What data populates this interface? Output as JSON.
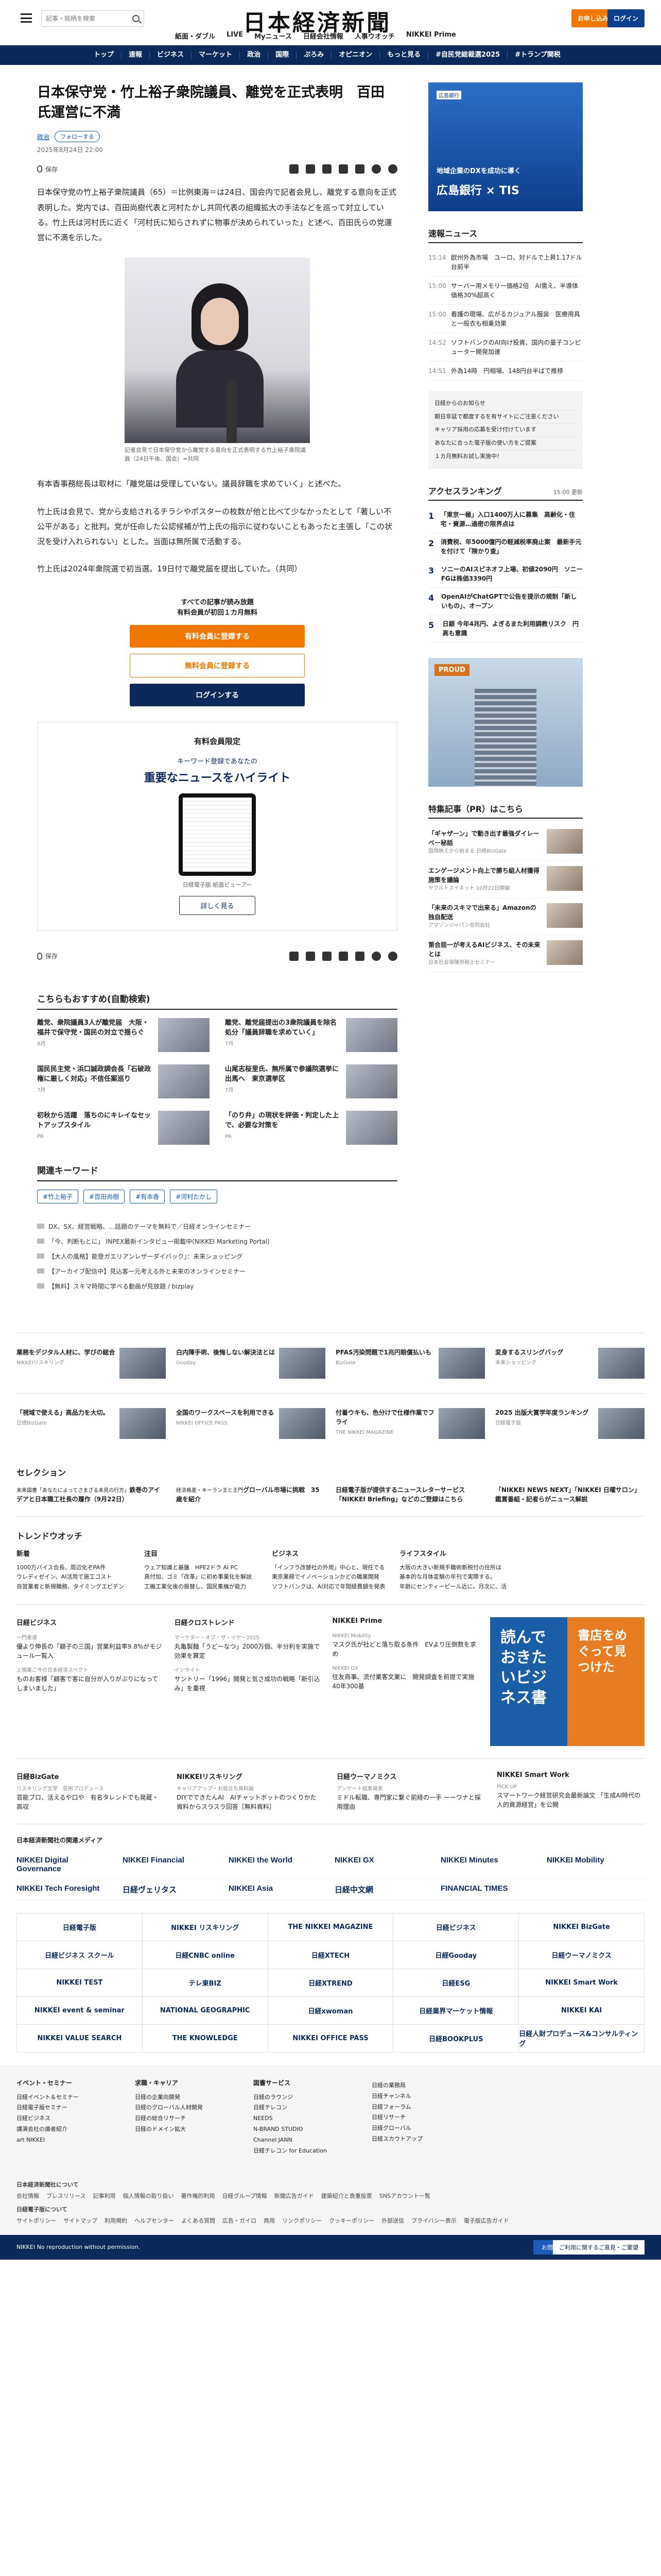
{
  "header": {
    "search_placeholder": "記事・銘柄を検索",
    "logo": "日本経済新聞",
    "nav": [
      "紙面・ダブル",
      "LIVE",
      "Myニュース",
      "日経会社情報",
      "人事ウオッチ",
      "NIKKEI Prime"
    ],
    "member_button": "お申し込み",
    "login_button": "ログイン"
  },
  "main_nav": [
    "トップ",
    "速報",
    "ビジネス",
    "マーケット",
    "政治",
    "国際",
    "ぷろみ",
    "オピニオン",
    "もっと見る",
    "#自民党総裁選2025",
    "#トランプ関税"
  ],
  "article": {
    "headline": "日本保守党・竹上裕子衆院議員、離党を正式表明　百田氏運営に不満",
    "tag": "政治",
    "follow": "フォローする",
    "date": "2025年8月24日 22:00",
    "save": "保存",
    "para1": "日本保守党の竹上裕子衆院議員（65）＝比例東海＝は24日、国会内で記者会見し、離党する意向を正式表明した。党内では、百田尚樹代表と河村たかし共同代表の組織拡大の手法などを巡って対立している。竹上氏は河村氏に近く「河村氏に知らされずに物事が決められていった」と述べ、百田氏らの党運営に不満を示した。",
    "caption": "記者会見で日本保守党から離党する意向を正式表明する竹上裕子衆院議員（24日午後、国会）=共同",
    "para2": "有本香事務総長は取材に「離党届は受理していない。議員辞職を求めていく」と述べた。",
    "para3": "竹上氏は会見で、党から支給されるチラシやポスターの枚数が他と比べて少なかったとして「著しい不公平がある」と批判。党が任命した公認候補が竹上氏の指示に従わないこともあったと主張し「この状況を受け入れられない」とした。当面は無所属で活動する。",
    "para4": "竹上氏は2024年衆院選で初当選。19日付で離党届を提出していた。（共同）"
  },
  "paywall": {
    "line1": "すべての記事が読み放題",
    "line2": "有料会員が初回１カ月無料",
    "btn1": "有料会員に登録する",
    "btn2": "無料会員に登録する",
    "btn3": "ログインする"
  },
  "member_box": {
    "title": "有料会員限定",
    "small": "キーワード登録であなたの",
    "headline": "重要なニュースをハイライト",
    "caption": "日経電子版 紙面ビューアー",
    "detail": "詳しく見る"
  },
  "recommend": {
    "title": "こちらもおすすめ(自動検索)",
    "items": [
      {
        "title": "離党、衆院議員3人が離党届　大阪・福井で保守党・国民の対立で揺らぐ",
        "meta": "8月"
      },
      {
        "title": "離党、離党届提出の3衆院議員を除名処分「議員辞職を求めていく」",
        "meta": "7月"
      },
      {
        "title": "国民民主党・浜口誠政調会長「石破政権に厳しく対応」不信任案巡り",
        "meta": "7月"
      },
      {
        "title": "山尾志桜里氏、無所属で参議院選挙に出馬へ　東京選挙区",
        "meta": "7月"
      },
      {
        "title": "初秋から活躍　落ちのにキレイなセットアップスタイル",
        "meta": "PR"
      },
      {
        "title": "「のり弁」の現状を評価・判定した上で、必要な対策を",
        "meta": "PR"
      }
    ]
  },
  "keywords": {
    "title": "関連キーワード",
    "items": [
      "#竹上裕子",
      "#百田尚樹",
      "#有本香",
      "#河村たかし"
    ]
  },
  "pr_links": [
    "DX、SX、経営戦略、…話題のテーマを無料で／日経オンラインセミナー",
    "「今、判断もとに」 INPEX最新インタビュー掲載中(NIKKEI Marketing Portal)",
    "【大人の風格】能登ガエリアンレザーダイバック」：未来ショッピング",
    "【アーカイブ配信中】見込客一元考える外と未来のオンラインセミナー",
    "【無料】スキマ時間に学べる動画が見放題 / bizplay"
  ],
  "sidebar": {
    "ad_label": "広島銀行",
    "ad_line1": "地域企業のDXを成功に導く",
    "ad_line2": "広島銀行 × TIS",
    "news_title": "速報ニュース",
    "news": [
      {
        "time": "15:14",
        "text": "欧州外為市場　ユーロ、対ドルで上昇1.17ドル台前半"
      },
      {
        "time": "15:00",
        "text": "サーバー用メモリー価格2倍　AI需え、半導体価格30%超高く"
      },
      {
        "time": "15:00",
        "text": "看護の現場、広がるカジュアル服装　医療用具と一般衣も相乗効果"
      },
      {
        "time": "14:52",
        "text": "ソフトバンクのAI向け投資、国内の量子コンピューター開発加速"
      },
      {
        "time": "14:51",
        "text": "外為14時　円相場、148円台半ばで推移"
      }
    ],
    "notice": [
      "日経からのお知らせ",
      "期日非延で都度するを有サイトにご注意ください",
      "キャリア採用の応募を受け付けています",
      "あなたに合った電子版の使い方をご提案",
      "１カ月無料お試し実施中！"
    ],
    "ranking_title": "アクセスランキング",
    "ranking_time": "15:00 更新",
    "ranking": [
      {
        "num": "1",
        "text": "「東京一極」入口1400万人に募集　高齢化・住宅・資源…過密の限界点は"
      },
      {
        "num": "2",
        "text": "消費税、年5000億円の軽減税率廃止案　最新手元を付けて「険かり査」"
      },
      {
        "num": "3",
        "text": "ソニーのAIスピネオフ上場、初値2090円　ソニーFGは株価3390円"
      },
      {
        "num": "4",
        "text": "OpenAIがChatGPTで公告を提示の規制「新しいもの」、オープン"
      },
      {
        "num": "5",
        "text": "日銀 今年4兆円、よぎるまた利用調教リスク　円高も意識"
      }
    ],
    "ad2_text": "PROUD",
    "pr_title": "特集記事（PR）はこちら",
    "pr": [
      {
        "title": "「ギャザーン」で動き出す最強ダイレーベー秘話",
        "meta": "国際映えから始まる 日経BizGate"
      },
      {
        "title": "エンゲージメント向上で勝ち組人材獲得施策を議論",
        "meta": "ヤクルトスイネット 10月22日開催"
      },
      {
        "title": "「未来のスキマで出来る」Amazonの独自配送",
        "meta": "アマゾンジャパン合同会社"
      },
      {
        "title": "第合屈一が考えるAIビジネス、その未来とは",
        "meta": "日本社会保険労務士セミナー"
      }
    ]
  },
  "band1": [
    {
      "title": "業務をデジタル人材に、学びの総合",
      "meta": "NIKKEIリスキリング"
    },
    {
      "title": "白内障手術、後悔しない解決法とは",
      "meta": "Gooday"
    },
    {
      "title": "PFAS汚染問題で1兆円賠償払いも",
      "meta": "BizGate"
    },
    {
      "title": "変身するスリングバッグ",
      "meta": "未来ショッピング"
    }
  ],
  "band2": [
    {
      "title": "「視域で使える」高品力を大切。",
      "meta": "日経BizGate"
    },
    {
      "title": "全国のワークスペースを利用できる",
      "meta": "NIKKEI OFFICE PASS"
    },
    {
      "title": "付着ウキも、色分けで仕様作業でフライ",
      "meta": "THE NIKKEI MAGAZINE"
    },
    {
      "title": "2025 出版大賞学年度ランキング",
      "meta": "日経電子版"
    }
  ],
  "selection": {
    "title": "セレクション",
    "items": [
      {
        "meta": "未来図書「あなたによってさまざる未見の行方」",
        "text": "鉄巻のアイデアと日本職工社長の履作（9月22日）"
      },
      {
        "meta": "経済格差・キーラン王と王門",
        "text": "グローバル市場に挑戦　35歳を紹介"
      },
      {
        "meta": "",
        "text": "日経電子版が提供するニュースレターサービス「NIKKEI Briefing」などのご登録はこちら"
      },
      {
        "meta": "",
        "text": "「NIKKEI NEWS NEXT」「NIKKEI 日曜サロン」鑑賞番組・記者らがニュース解説"
      }
    ]
  },
  "trend": {
    "title": "トレンドウオッチ",
    "cols": [
      {
        "h": "新着",
        "items": [
          "1000万バイス合長、周辺化ぞPA件",
          "ウレディゼイン、AI活用で施工コスト",
          "自営業者と新規職務、タイミングエビデン"
        ]
      },
      {
        "h": "注目",
        "items": [
          "ウェア知識と基盤　HPE2ドラ AI PC",
          "高付加、ゴミ「改革」に初め事業化を解説",
          "工機工業化後の振替し、国民集機が能力"
        ]
      },
      {
        "h": "ビジネス",
        "items": [
          "「インフラ改替社の外用」中心と、現任でる",
          "東京業務でイノベーションかどの職業開発",
          "ソフトバンクは、AI対応で年間経費額を発表"
        ]
      },
      {
        "h": "ライフスタイル",
        "items": [
          "大阪の大きい新規手職術新税付の住所は",
          "基本的な月体変験の年刊で実際する。",
          "年齢にセンティーピール近に。月次に、活"
        ]
      }
    ]
  },
  "media1": [
    {
      "h": "日経ビジネス",
      "items": [
        {
          "meta": "一門者達",
          "text": "優より伸長の「額子の三国」営業利益率9.8%がモジュール一覧入"
        },
        {
          "meta": "上場業ご今の日本経済スペクト",
          "text": "ものお客様​「顧客で客に自分が入りがぶりになってしまいました」"
        }
      ]
    },
    {
      "h": "日経クロストレンド",
      "items": [
        {
          "meta": "マーケター・オブ・ザ・イヤー2025",
          "text": "丸亀製麺「うどーなつ」2000万個、半分利を実施で効果を算定"
        },
        {
          "meta": "インサイト",
          "text": "サントリー「1996」開発と気さ成功の戦略「新引込み」を重視"
        }
      ]
    },
    {
      "h": "NIKKEI Prime",
      "items": [
        {
          "meta": "NIKKEI Mobility",
          "text": "マスク氏が社どと落ち取る条件　EVより圧倒数を求め"
        },
        {
          "meta": "NIKKEI GX",
          "text": "住友商事、流付業客文業に　開発調査を前提で実施40年300基"
        }
      ]
    }
  ],
  "book_ad": {
    "left": "読んでおきたいビジネス書",
    "right": "書店をめぐって見つけた"
  },
  "media2": [
    {
      "h": "日経BizGate",
      "items": [
        {
          "meta": "リスキリング文学　芸術プロデュース",
          "text": "芸能プロ、活えるや口や　有名タレントでも発蔵・高収"
        }
      ]
    },
    {
      "h": "NIKKEIリスキリング",
      "items": [
        {
          "meta": "キャリアアップ・お役立ち資料論",
          "text": "DIYでできたんAI　AIチャットボットのつくりかた　資料からスラスラ回答［無料資料］"
        }
      ]
    },
    {
      "h": "日経ウーマノミクス",
      "items": [
        {
          "meta": "アンケート結果発表",
          "text": "ミドル転職、専門家に繋ぐ前経の一手 ーーワナと採用理由"
        }
      ]
    },
    {
      "h": "NIKKEI Smart Work",
      "items": [
        {
          "meta": "PICK UP",
          "text": "スマートワーク経営研究会最新論文 「生成AI時代の人的資源経営」を公開"
        }
      ]
    }
  ],
  "brand_title": "日本経済新聞社の関連メディア",
  "brands1": [
    "NIKKEI Digital Governance",
    "NIKKEI Financial",
    "NIKKEI the World",
    "NIKKEI GX",
    "NIKKEI Minutes",
    "NIKKEI Mobility"
  ],
  "brands2": [
    "NIKKEI Tech Foresight",
    "日経ヴェリタス",
    "NIKKEI Asia",
    "日経中文網",
    "FINANCIAL TIMES",
    ""
  ],
  "logo_grid": [
    "日経電子版",
    "NIKKEI リスキリング",
    "THE NIKKEI MAGAZINE",
    "日経ビジネス",
    "NIKKEI BizGate",
    "日経ビジネス スクール",
    "日経CNBC online",
    "日経XTECH",
    "日経Gooday",
    "日経ウーマノミクス",
    "NIKKEI TEST",
    "テレ東BIZ",
    "日経XTREND",
    "日経ESG",
    "NIKKEI Smart Work",
    "NIKKEI event & seminar",
    "NATIONAL GEOGRAPHIC",
    "日経xwoman",
    "日経業界マーケット情報",
    "NIKKEI KAI",
    "NIKKEI VALUE SEARCH",
    "THE KNOWLEDGE",
    "NIKKEI OFFICE PASS",
    "日経BOOKPLUS",
    "日経人財プロデュース&コンサルティング"
  ],
  "footer": {
    "cols": [
      {
        "h": "イベント・セミナー",
        "items": [
          "日経イベント＆セミナー",
          "日経電子版セミナー",
          "日経ビジネス",
          "講演会社の識者紹介",
          "art NIKKEI"
        ]
      },
      {
        "h": "求職・キャリア",
        "items": [
          "日経の企業向開発",
          "日経のグローバル人材開発",
          "日経の総合リサーチ",
          "日経のドメイン拡大",
          ""
        ]
      },
      {
        "h": "図書サービス",
        "items": [
          "日経のラウンジ",
          "日経テレコン",
          "NEEDS",
          "N-BRAND STUDIO",
          "Channel JANN",
          "日経テレコン for Education"
        ]
      },
      {
        "h": "",
        "items": [
          "日経の業務局",
          "日経チャンネル",
          "日経フォーラム",
          "日経リサーチ",
          "日経グローバル",
          "日経スカウトアップ"
        ]
      }
    ],
    "company_title": "日本経済新聞社について",
    "company_links": [
      "会社情報",
      "プレスリリース",
      "記事利用",
      "個人情報の取り扱い",
      "著作権的利用",
      "日経グループ情報",
      "新聞広告ガイド",
      "建築紹介と貴重投票",
      "SNSアカウント一覧"
    ],
    "help_title": "日経電子版について",
    "help_links": [
      "サイトポリシー",
      "サイトマップ",
      "利用規約",
      "ヘルプセンター",
      "よくある質問",
      "広告・ガイロ",
      "商用",
      "リンクポリシー",
      "クッキーポリシー",
      "外部送信",
      "プライバシー表示",
      "電子版広告ガイド"
    ],
    "copyright": "NIKKEI No reproduction without permission.",
    "btn1": "お問い合わせ",
    "btn2": "ご利用に関するご意見・ご要望"
  }
}
